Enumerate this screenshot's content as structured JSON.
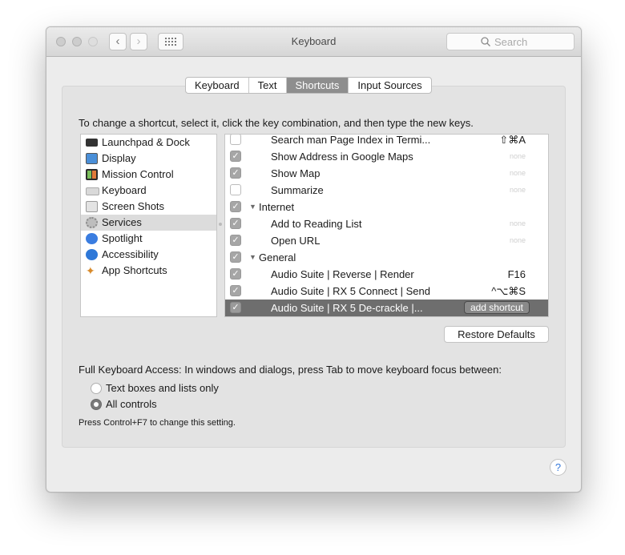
{
  "window": {
    "title": "Keyboard"
  },
  "search": {
    "placeholder": "Search"
  },
  "tabs": [
    {
      "label": "Keyboard",
      "active": false
    },
    {
      "label": "Text",
      "active": false
    },
    {
      "label": "Shortcuts",
      "active": true
    },
    {
      "label": "Input Sources",
      "active": false
    }
  ],
  "instruction": "To change a shortcut, select it, click the key combination, and then type the new keys.",
  "categories": [
    {
      "label": "Launchpad & Dock",
      "icon": "launchpad-dock-icon",
      "selected": false
    },
    {
      "label": "Display",
      "icon": "display-icon",
      "selected": false
    },
    {
      "label": "Mission Control",
      "icon": "mission-control-icon",
      "selected": false
    },
    {
      "label": "Keyboard",
      "icon": "keyboard-icon",
      "selected": false
    },
    {
      "label": "Screen Shots",
      "icon": "screenshot-icon",
      "selected": false
    },
    {
      "label": "Services",
      "icon": "gear-icon",
      "selected": true
    },
    {
      "label": "Spotlight",
      "icon": "spotlight-icon",
      "selected": false
    },
    {
      "label": "Accessibility",
      "icon": "accessibility-icon",
      "selected": false
    },
    {
      "label": "App Shortcuts",
      "icon": "app-shortcuts-icon",
      "selected": false
    }
  ],
  "shortcuts": [
    {
      "label": "Search man Page Index in Termi...",
      "key": "⇧⌘A",
      "checked": false,
      "group": false
    },
    {
      "label": "Show Address in Google Maps",
      "key": "none",
      "checked": true,
      "group": false
    },
    {
      "label": "Show Map",
      "key": "none",
      "checked": true,
      "group": false
    },
    {
      "label": "Summarize",
      "key": "none",
      "checked": false,
      "group": false
    },
    {
      "label": "Internet",
      "key": "",
      "checked": true,
      "group": true
    },
    {
      "label": "Add to Reading List",
      "key": "none",
      "checked": true,
      "group": false
    },
    {
      "label": "Open URL",
      "key": "none",
      "checked": true,
      "group": false
    },
    {
      "label": "General",
      "key": "",
      "checked": true,
      "group": true
    },
    {
      "label": "Audio Suite | Reverse | Render",
      "key": "F16",
      "checked": true,
      "group": false
    },
    {
      "label": "Audio Suite | RX 5 Connect | Send",
      "key": "^⌥⌘S",
      "checked": true,
      "group": false
    },
    {
      "label": "Audio Suite | RX 5 De-crackle |...",
      "key": "",
      "checked": true,
      "group": false,
      "selected": true,
      "action": "add shortcut"
    }
  ],
  "restore_defaults": "Restore Defaults",
  "full_keyboard_access": {
    "label": "Full Keyboard Access: In windows and dialogs, press Tab to move keyboard focus between:",
    "options": [
      {
        "label": "Text boxes and lists only",
        "selected": false
      },
      {
        "label": "All controls",
        "selected": true
      }
    ],
    "hint": "Press Control+F7 to change this setting."
  },
  "help": "?",
  "colors": {
    "selection": "#6e6e6e",
    "tab_active": "#8e8e8e",
    "help_accent": "#3478d9"
  }
}
